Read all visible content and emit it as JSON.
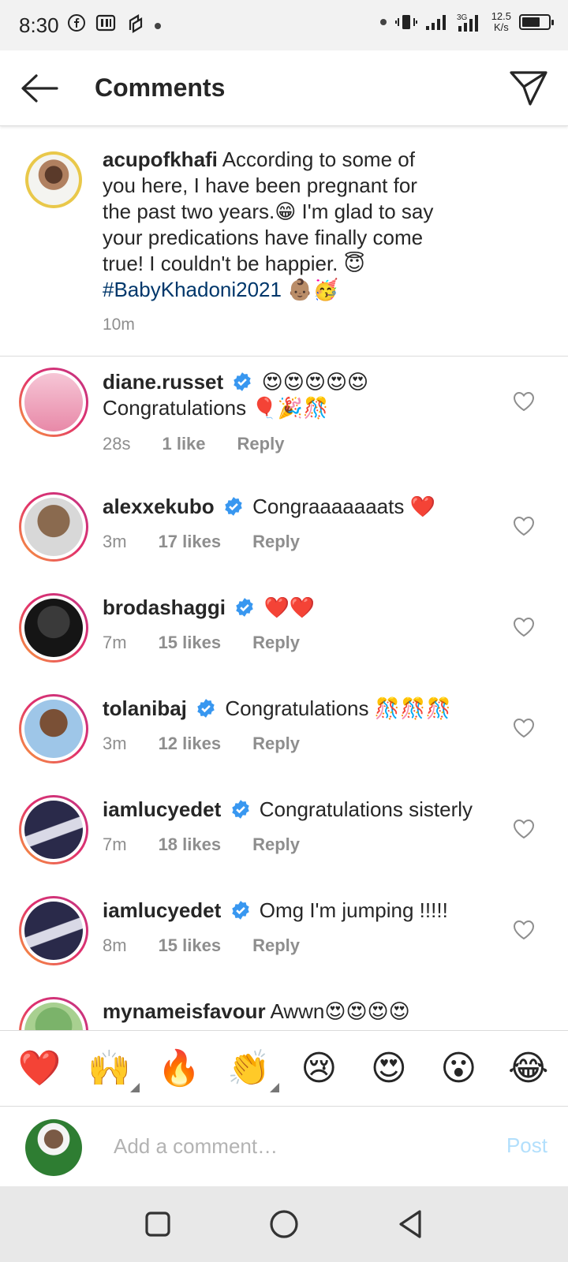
{
  "status_bar": {
    "time": "8:30",
    "net_speed_value": "12.5",
    "net_speed_unit": "K/s"
  },
  "header": {
    "title": "Comments"
  },
  "caption": {
    "username": "acupofkhafi",
    "text": "According to some of you here, I have been pregnant for the past two years.😁 I'm glad to say your predications have finally come true! I couldn't be happier. 😇",
    "hashtag": "#BabyKhadoni2021",
    "hashtag_emoji": "👶🏽🥳",
    "time": "10m"
  },
  "comments": [
    {
      "username": "diane.russet",
      "verified": true,
      "text": "😍😍😍😍😍 Congratulations 🎈🎉🎊",
      "time": "28s",
      "likes": "1 like",
      "reply": "Reply",
      "avatar_color": "#f6c6d6"
    },
    {
      "username": "alexxekubo",
      "verified": true,
      "text": "Congraaaaaaats ❤️",
      "time": "3m",
      "likes": "17 likes",
      "reply": "Reply",
      "avatar_color": "#8a6a4f"
    },
    {
      "username": "brodashaggi",
      "verified": true,
      "text": "❤️❤️",
      "time": "7m",
      "likes": "15 likes",
      "reply": "Reply",
      "avatar_color": "#2b2b2b"
    },
    {
      "username": "tolanibaj",
      "verified": true,
      "text": "Congratulations 🎊🎊🎊",
      "time": "3m",
      "likes": "12 likes",
      "reply": "Reply",
      "avatar_color": "#9ec6e8"
    },
    {
      "username": "iamlucyedet",
      "verified": true,
      "text": "Congratulations sisterly",
      "time": "7m",
      "likes": "18 likes",
      "reply": "Reply",
      "avatar_color": "#2a2a4a"
    },
    {
      "username": "iamlucyedet",
      "verified": true,
      "text": "Omg I'm jumping !!!!!",
      "time": "8m",
      "likes": "15 likes",
      "reply": "Reply",
      "avatar_color": "#2a2a4a"
    },
    {
      "username": "mynameisfavour",
      "verified": false,
      "text": "Awwn😍😍😍😍",
      "time": "",
      "likes": "",
      "reply": "",
      "avatar_color": "#7bb36a"
    }
  ],
  "emoji_bar": [
    "❤️",
    "🙌",
    "🔥",
    "👏",
    "😢",
    "😍",
    "😮",
    "😂"
  ],
  "add_comment": {
    "placeholder": "Add a comment…",
    "post_label": "Post"
  },
  "colors": {
    "link": "#00376b",
    "verified": "#3897f0",
    "muted": "#8e8e8e",
    "post_disabled": "#b2dffc"
  }
}
